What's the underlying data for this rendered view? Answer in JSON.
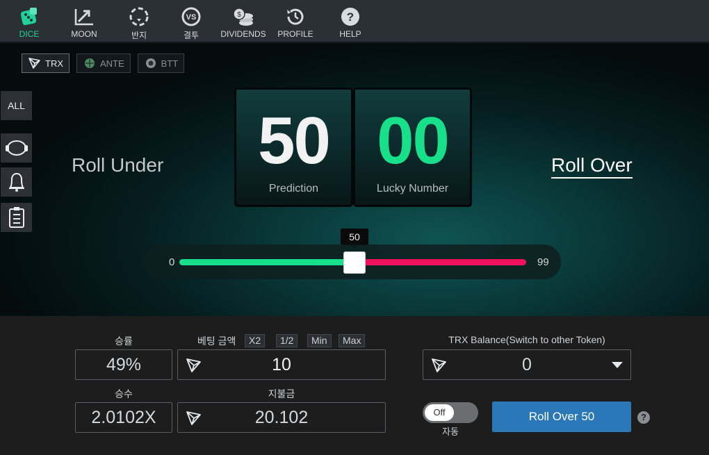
{
  "nav": {
    "items": [
      {
        "label": "DICE",
        "icon": "dice-icon"
      },
      {
        "label": "MOON",
        "icon": "chart-up-icon"
      },
      {
        "label": "반지",
        "icon": "ring-icon"
      },
      {
        "label": "결투",
        "icon": "vs-icon"
      },
      {
        "label": "DIVIDENDS",
        "icon": "coins-icon"
      },
      {
        "label": "PROFILE",
        "icon": "history-icon"
      },
      {
        "label": "HELP",
        "icon": "help-icon"
      }
    ],
    "active": "DICE",
    "accent_color": "#1fd29a"
  },
  "tokens": [
    {
      "label": "TRX",
      "active": true
    },
    {
      "label": "ANTE",
      "active": false
    },
    {
      "label": "BTT",
      "active": false
    }
  ],
  "side": {
    "all_label": "ALL"
  },
  "game": {
    "roll_under": "Roll Under",
    "roll_over": "Roll Over",
    "prediction_value": "50",
    "prediction_label": "Prediction",
    "lucky_value": "00",
    "lucky_label": "Lucky Number",
    "lucky_color": "#18e08a",
    "slider": {
      "min": "0",
      "max": "99",
      "value": 50,
      "value_label": "50"
    }
  },
  "controls": {
    "win_chance_label": "승률",
    "win_chance_value": "49%",
    "bet_label": "베팅 금액",
    "bet_chips": [
      "X2",
      "1/2",
      "Min",
      "Max"
    ],
    "bet_value": "10",
    "multiplier_label": "승수",
    "multiplier_value": "2.0102X",
    "payout_label": "지불금",
    "payout_value": "20.102",
    "balance_label": "TRX Balance(Switch to other Token)",
    "balance_value": "0",
    "auto_toggle": "Off",
    "auto_label": "자동",
    "roll_button": "Roll Over 50",
    "help": "?"
  }
}
